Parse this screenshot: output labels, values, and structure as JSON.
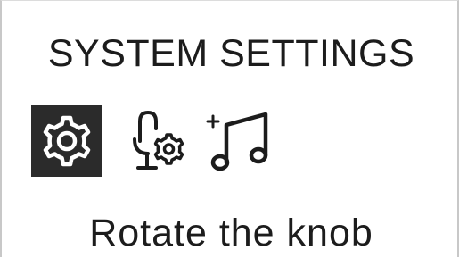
{
  "screen": {
    "title": "SYSTEM SETTINGS",
    "hint": "Rotate the knob"
  },
  "menu": {
    "items": [
      {
        "icon": "gear-icon",
        "selected": true
      },
      {
        "icon": "microphone-settings-icon",
        "selected": false
      },
      {
        "icon": "add-music-icon",
        "selected": false
      }
    ]
  },
  "colors": {
    "text": "#1c1c1c",
    "selected_background": "#2b2b2b",
    "selected_foreground": "#ffffff",
    "background": "#ffffff"
  }
}
